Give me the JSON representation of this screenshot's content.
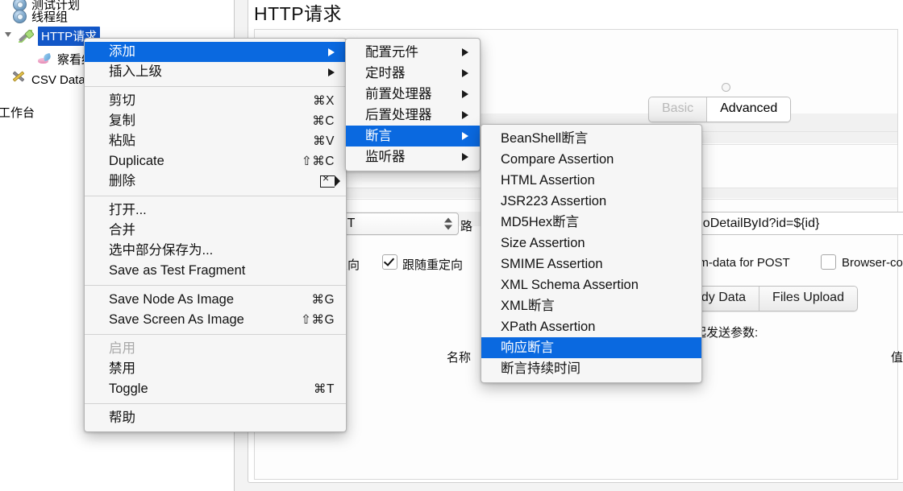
{
  "window": {
    "title": "HTTP请求"
  },
  "tree": {
    "items": [
      {
        "label": "测试计划",
        "icon": "plan-icon",
        "selected": false
      },
      {
        "label": "线程组",
        "icon": "thread-group-icon",
        "selected": false
      },
      {
        "label": "HTTP请求",
        "icon": "http-sampler-icon",
        "selected": true
      },
      {
        "label": "察看结果树",
        "icon": "view-results-tree-icon",
        "selected": false
      },
      {
        "label": "CSV Data Set Config",
        "icon": "csv-data-set-icon",
        "selected": false
      },
      {
        "label": "工作台",
        "icon": "workbench-icon",
        "selected": false
      }
    ]
  },
  "request_panel": {
    "title": "HTTP请求",
    "mode_tabs": [
      {
        "label": "Basic",
        "active": false,
        "dim": true
      },
      {
        "label": "Advanced",
        "active": true,
        "dim": false
      }
    ],
    "method_value": "ET",
    "path_value": "deoDetailById?id=${id}",
    "redirect_auto_label": "定向",
    "follow_redirects_label": "跟随重定向",
    "follow_redirects_checked": true,
    "multipart_label": "orm-data for POST",
    "browser_compat_label": "Browser-co",
    "browser_compat_checked": false,
    "param_tabs": [
      {
        "label": "ody Data",
        "active": false
      },
      {
        "label": "Files Upload",
        "active": false
      }
    ],
    "send_params_label": "一起发送参数:",
    "table_headers": [
      "名称",
      "值"
    ]
  },
  "context_menu": {
    "items": [
      {
        "label": "添加",
        "accel": "",
        "submenu": true,
        "selected": true,
        "disabled": false
      },
      {
        "label": "插入上级",
        "accel": "",
        "submenu": true,
        "selected": false,
        "disabled": false
      },
      {
        "separator": true
      },
      {
        "label": "剪切",
        "accel": "⌘X",
        "submenu": false,
        "selected": false,
        "disabled": false
      },
      {
        "label": "复制",
        "accel": "⌘C",
        "submenu": false,
        "selected": false,
        "disabled": false
      },
      {
        "label": "粘贴",
        "accel": "⌘V",
        "submenu": false,
        "selected": false,
        "disabled": false
      },
      {
        "label": "Duplicate",
        "accel": "⇧⌘C",
        "submenu": false,
        "selected": false,
        "disabled": false
      },
      {
        "label": "删除",
        "accel": "delete-icon",
        "submenu": false,
        "selected": false,
        "disabled": false
      },
      {
        "separator": true
      },
      {
        "label": "打开...",
        "accel": "",
        "submenu": false,
        "selected": false,
        "disabled": false
      },
      {
        "label": "合并",
        "accel": "",
        "submenu": false,
        "selected": false,
        "disabled": false
      },
      {
        "label": "选中部分保存为...",
        "accel": "",
        "submenu": false,
        "selected": false,
        "disabled": false
      },
      {
        "label": "Save as Test Fragment",
        "accel": "",
        "submenu": false,
        "selected": false,
        "disabled": false
      },
      {
        "separator": true
      },
      {
        "label": "Save Node As Image",
        "accel": "⌘G",
        "submenu": false,
        "selected": false,
        "disabled": false
      },
      {
        "label": "Save Screen As Image",
        "accel": "⇧⌘G",
        "submenu": false,
        "selected": false,
        "disabled": false
      },
      {
        "separator": true
      },
      {
        "label": "启用",
        "accel": "",
        "submenu": false,
        "selected": false,
        "disabled": true
      },
      {
        "label": "禁用",
        "accel": "",
        "submenu": false,
        "selected": false,
        "disabled": false
      },
      {
        "label": "Toggle",
        "accel": "⌘T",
        "submenu": false,
        "selected": false,
        "disabled": false
      },
      {
        "separator": true
      },
      {
        "label": "帮助",
        "accel": "",
        "submenu": false,
        "selected": false,
        "disabled": false
      }
    ]
  },
  "add_submenu": {
    "items": [
      {
        "label": "配置元件",
        "submenu": true,
        "selected": false
      },
      {
        "label": "定时器",
        "submenu": true,
        "selected": false
      },
      {
        "label": "前置处理器",
        "submenu": true,
        "selected": false
      },
      {
        "label": "后置处理器",
        "submenu": true,
        "selected": false
      },
      {
        "label": "断言",
        "submenu": true,
        "selected": true
      },
      {
        "label": "监听器",
        "submenu": true,
        "selected": false
      }
    ]
  },
  "assertion_submenu": {
    "items": [
      {
        "label": "BeanShell断言",
        "selected": false
      },
      {
        "label": "Compare Assertion",
        "selected": false
      },
      {
        "label": "HTML Assertion",
        "selected": false
      },
      {
        "label": "JSR223 Assertion",
        "selected": false
      },
      {
        "label": "MD5Hex断言",
        "selected": false
      },
      {
        "label": "Size Assertion",
        "selected": false
      },
      {
        "label": "SMIME Assertion",
        "selected": false
      },
      {
        "label": "XML Schema Assertion",
        "selected": false
      },
      {
        "label": "XML断言",
        "selected": false
      },
      {
        "label": "XPath Assertion",
        "selected": false
      },
      {
        "label": "响应断言",
        "selected": true
      },
      {
        "label": "断言持续时间",
        "selected": false
      }
    ]
  },
  "colors": {
    "menu_highlight": "#0a69e0",
    "tree_selection": "#1257c8",
    "menu_bg": "#f6f6f6"
  }
}
